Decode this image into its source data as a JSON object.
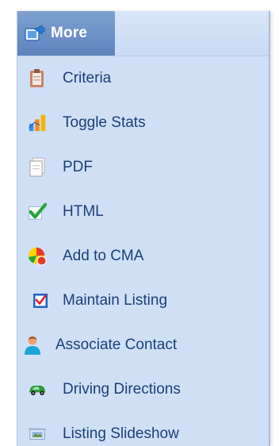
{
  "header": {
    "title": "More",
    "icon": "export-icon"
  },
  "menu": {
    "items": [
      {
        "label": "Criteria",
        "icon": "clipboard-icon"
      },
      {
        "label": "Toggle Stats",
        "icon": "bar-chart-icon"
      },
      {
        "label": "PDF",
        "icon": "document-icon"
      },
      {
        "label": "HTML",
        "icon": "checkmark-icon"
      },
      {
        "label": "Add to CMA",
        "icon": "pie-chart-icon"
      },
      {
        "label": "Maintain Listing",
        "icon": "checked-box-icon"
      },
      {
        "label": "Associate Contact",
        "icon": "person-icon"
      },
      {
        "label": "Driving Directions",
        "icon": "car-icon"
      },
      {
        "label": "Listing Slideshow",
        "icon": "slideshow-icon"
      }
    ]
  },
  "colors": {
    "panel_bg": "#cfe0f6",
    "header_tab": "#6a8dc5",
    "label_text": "#1a3f79"
  }
}
